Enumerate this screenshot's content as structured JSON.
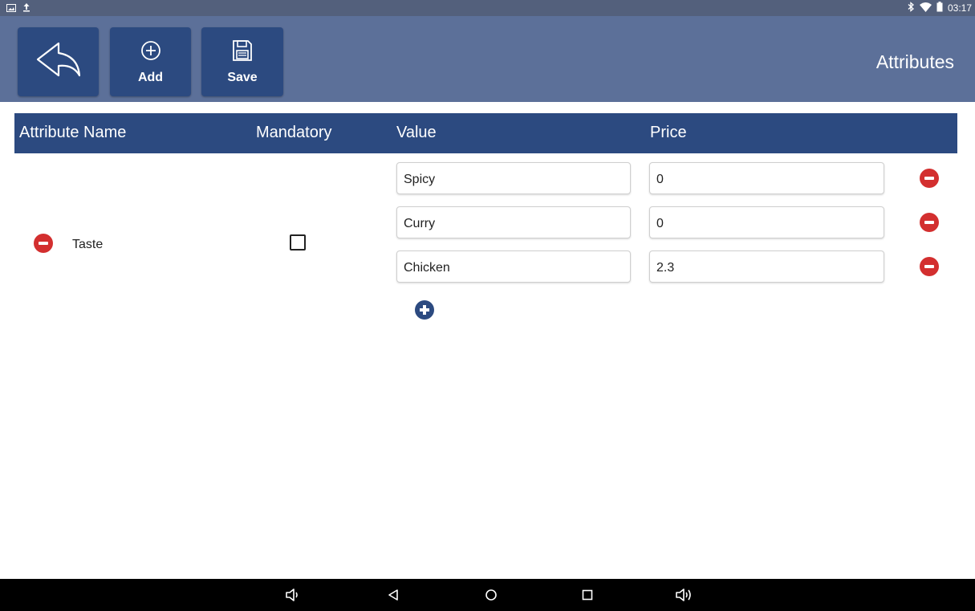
{
  "statusbar": {
    "time": "03:17",
    "icons_left": [
      "image-icon",
      "upload-icon"
    ],
    "icons_right": [
      "bluetooth-icon",
      "wifi-icon",
      "battery-icon"
    ]
  },
  "toolbar": {
    "back_icon": "back-arrow-icon",
    "add_label": "Add",
    "save_label": "Save",
    "title": "Attributes"
  },
  "table": {
    "headers": {
      "name": "Attribute Name",
      "mandatory": "Mandatory",
      "value": "Value",
      "price": "Price"
    },
    "attribute": {
      "name": "Taste",
      "mandatory": false,
      "values": [
        {
          "value": "Spicy",
          "price": "0"
        },
        {
          "value": "Curry",
          "price": "0"
        },
        {
          "value": "Chicken",
          "price": "2.3"
        }
      ]
    }
  },
  "colors": {
    "toolbar": "#5c7099",
    "button": "#2c4a80",
    "header": "#2c4a80",
    "remove": "#d32f2f"
  },
  "navbar": {
    "icons": [
      "volume-down-icon",
      "nav-back-icon",
      "home-icon",
      "recents-icon",
      "volume-up-icon"
    ]
  }
}
